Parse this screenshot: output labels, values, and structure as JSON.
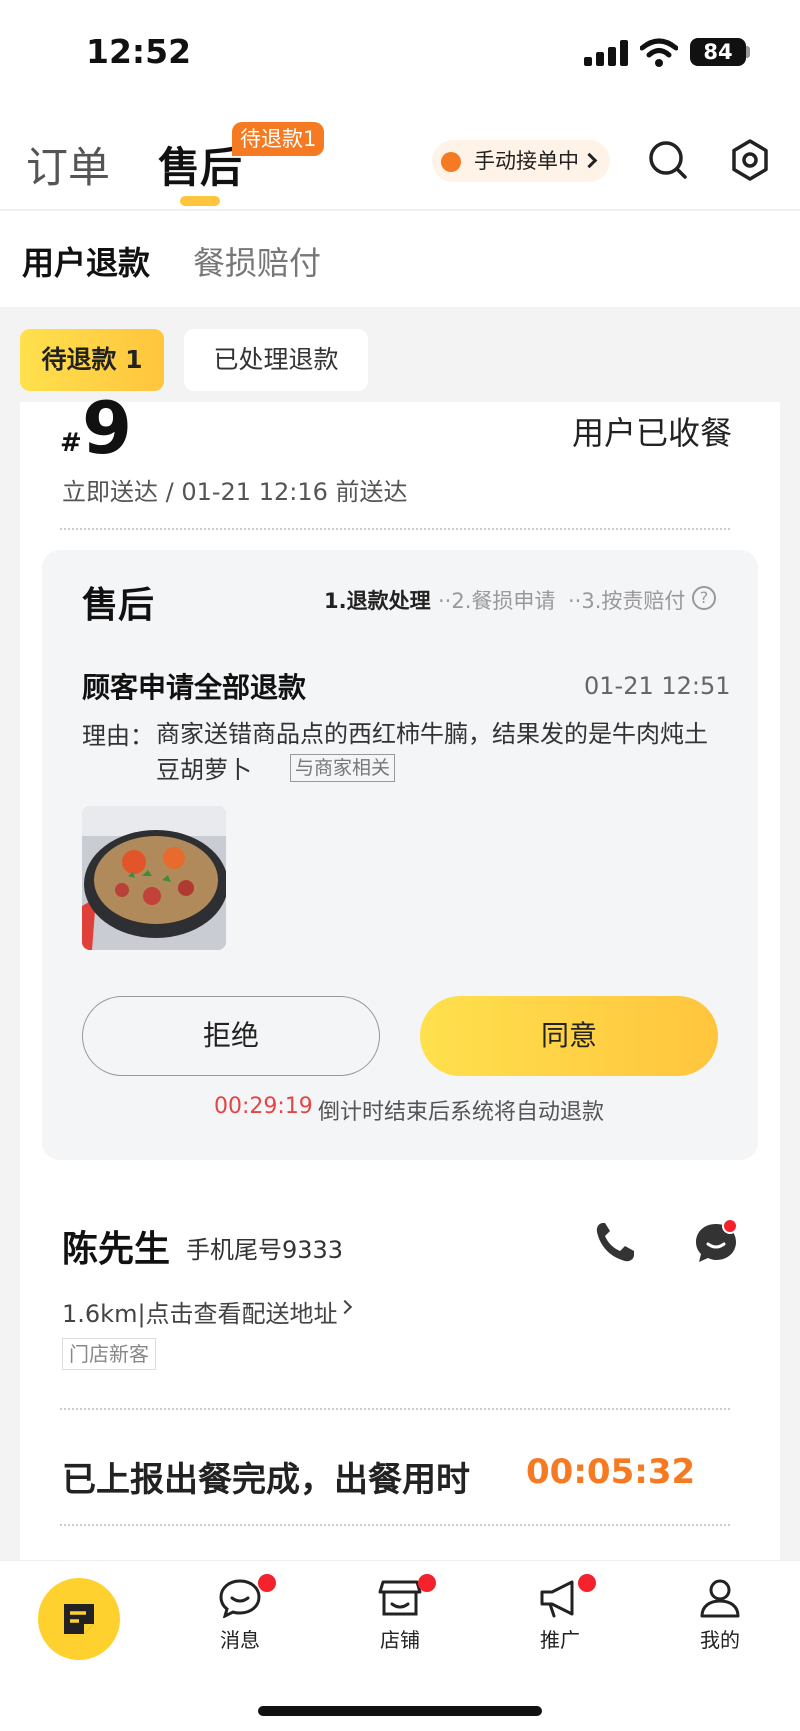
{
  "status_bar": {
    "time": "12:52",
    "battery": "84"
  },
  "header": {
    "tab_orders": "订单",
    "tab_aftersale": "售后",
    "pending_badge": "待退款1",
    "manual_accept": "手动接单中"
  },
  "subtabs": {
    "refund": "用户退款",
    "damage": "餐损赔付"
  },
  "filters": {
    "pending": "待退款 1",
    "processed": "已处理退款"
  },
  "order": {
    "hash": "#",
    "number": "9",
    "status": "用户已收餐",
    "delivery": "立即送达 / 01-21 12:16 前送达"
  },
  "aftersale": {
    "title": "售后",
    "step1": "1.退款处理",
    "step2": "··2.餐损申请",
    "step3": "··3.按责赔付",
    "help": "?",
    "request_title": "顾客申请全部退款",
    "request_time": "01-21 12:51",
    "reason_label": "理由：",
    "reason_text": "商家送错商品点的西红柿牛腩，结果发的是牛肉炖土豆胡萝卜",
    "reason_tag": "与商家相关",
    "reject": "拒绝",
    "agree": "同意",
    "countdown": "00:29:19",
    "countdown_note": "倒计时结束后系统将自动退款"
  },
  "customer": {
    "name": "陈先生",
    "phone": "手机尾号9333",
    "distance": "1.6km|点击查看配送地址",
    "tag": "门店新客"
  },
  "meal": {
    "label": "已上报出餐完成，出餐用时",
    "time": "00:05:32"
  },
  "nav": {
    "messages": "消息",
    "store": "店铺",
    "promote": "推广",
    "mine": "我的"
  },
  "colors": {
    "accent": "#ffc53d",
    "orange": "#f57a22",
    "red": "#e64545"
  }
}
